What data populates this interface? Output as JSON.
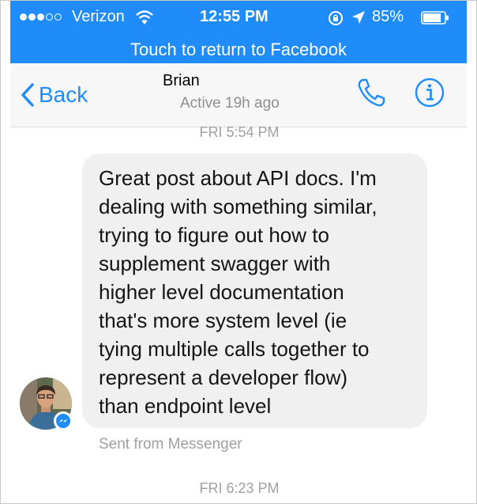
{
  "status_bar": {
    "carrier": "Verizon",
    "time": "12:55 PM",
    "battery": "85%",
    "battery_level": 0.85
  },
  "banner": {
    "text": "Touch to return to Facebook"
  },
  "nav": {
    "back_label": "Back",
    "contact_name": "Brian",
    "active_status": "Active 19h ago",
    "icons": [
      "chevron-left-icon",
      "phone-icon",
      "info-icon"
    ],
    "accent_color": "#1f8cf9"
  },
  "conversation": {
    "timestamp_first": "FRI 5:54 PM",
    "message_text": "Great post about API docs. I'm\ndealing with something similar,\ntrying to figure out how to\nsupplement swagger with\nhigher level documentation\nthat's more system level (ie\ntying multiple calls together to\nrepresent a developer flow)\nthan endpoint level",
    "sent_via": "Sent from Messenger",
    "timestamp_second": "FRI 6:23 PM"
  }
}
